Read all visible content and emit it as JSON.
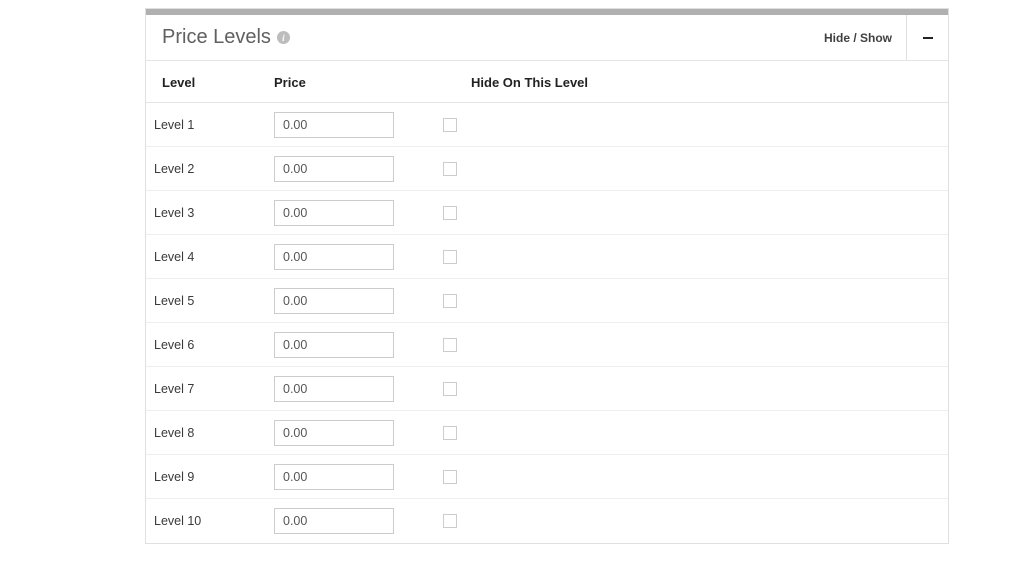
{
  "panel": {
    "title": "Price Levels",
    "info_icon": "info-icon",
    "hide_show_label": "Hide / Show",
    "collapse_icon": "minus-icon"
  },
  "columns": {
    "level": "Level",
    "price": "Price",
    "hide": "Hide On This Level"
  },
  "rows": [
    {
      "label": "Level 1",
      "price": "0.00",
      "hide": false
    },
    {
      "label": "Level 2",
      "price": "0.00",
      "hide": false
    },
    {
      "label": "Level 3",
      "price": "0.00",
      "hide": false
    },
    {
      "label": "Level 4",
      "price": "0.00",
      "hide": false
    },
    {
      "label": "Level 5",
      "price": "0.00",
      "hide": false
    },
    {
      "label": "Level 6",
      "price": "0.00",
      "hide": false
    },
    {
      "label": "Level 7",
      "price": "0.00",
      "hide": false
    },
    {
      "label": "Level 8",
      "price": "0.00",
      "hide": false
    },
    {
      "label": "Level 9",
      "price": "0.00",
      "hide": false
    },
    {
      "label": "Level 10",
      "price": "0.00",
      "hide": false
    }
  ]
}
